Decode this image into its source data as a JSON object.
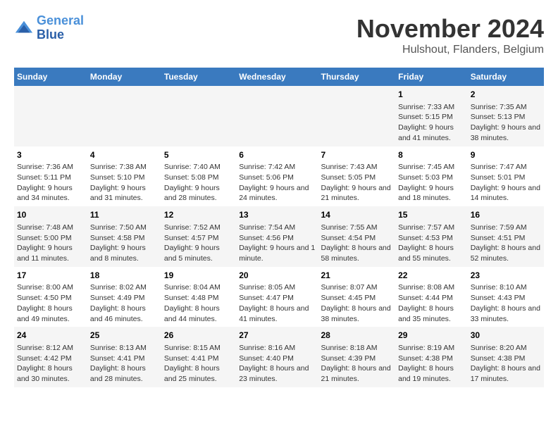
{
  "header": {
    "logo_line1": "General",
    "logo_line2": "Blue",
    "title": "November 2024",
    "subtitle": "Hulshout, Flanders, Belgium"
  },
  "days_of_week": [
    "Sunday",
    "Monday",
    "Tuesday",
    "Wednesday",
    "Thursday",
    "Friday",
    "Saturday"
  ],
  "weeks": [
    [
      {
        "day": "",
        "sunrise": "",
        "sunset": "",
        "daylight": ""
      },
      {
        "day": "",
        "sunrise": "",
        "sunset": "",
        "daylight": ""
      },
      {
        "day": "",
        "sunrise": "",
        "sunset": "",
        "daylight": ""
      },
      {
        "day": "",
        "sunrise": "",
        "sunset": "",
        "daylight": ""
      },
      {
        "day": "",
        "sunrise": "",
        "sunset": "",
        "daylight": ""
      },
      {
        "day": "1",
        "sunrise": "Sunrise: 7:33 AM",
        "sunset": "Sunset: 5:15 PM",
        "daylight": "Daylight: 9 hours and 41 minutes."
      },
      {
        "day": "2",
        "sunrise": "Sunrise: 7:35 AM",
        "sunset": "Sunset: 5:13 PM",
        "daylight": "Daylight: 9 hours and 38 minutes."
      }
    ],
    [
      {
        "day": "3",
        "sunrise": "Sunrise: 7:36 AM",
        "sunset": "Sunset: 5:11 PM",
        "daylight": "Daylight: 9 hours and 34 minutes."
      },
      {
        "day": "4",
        "sunrise": "Sunrise: 7:38 AM",
        "sunset": "Sunset: 5:10 PM",
        "daylight": "Daylight: 9 hours and 31 minutes."
      },
      {
        "day": "5",
        "sunrise": "Sunrise: 7:40 AM",
        "sunset": "Sunset: 5:08 PM",
        "daylight": "Daylight: 9 hours and 28 minutes."
      },
      {
        "day": "6",
        "sunrise": "Sunrise: 7:42 AM",
        "sunset": "Sunset: 5:06 PM",
        "daylight": "Daylight: 9 hours and 24 minutes."
      },
      {
        "day": "7",
        "sunrise": "Sunrise: 7:43 AM",
        "sunset": "Sunset: 5:05 PM",
        "daylight": "Daylight: 9 hours and 21 minutes."
      },
      {
        "day": "8",
        "sunrise": "Sunrise: 7:45 AM",
        "sunset": "Sunset: 5:03 PM",
        "daylight": "Daylight: 9 hours and 18 minutes."
      },
      {
        "day": "9",
        "sunrise": "Sunrise: 7:47 AM",
        "sunset": "Sunset: 5:01 PM",
        "daylight": "Daylight: 9 hours and 14 minutes."
      }
    ],
    [
      {
        "day": "10",
        "sunrise": "Sunrise: 7:48 AM",
        "sunset": "Sunset: 5:00 PM",
        "daylight": "Daylight: 9 hours and 11 minutes."
      },
      {
        "day": "11",
        "sunrise": "Sunrise: 7:50 AM",
        "sunset": "Sunset: 4:58 PM",
        "daylight": "Daylight: 9 hours and 8 minutes."
      },
      {
        "day": "12",
        "sunrise": "Sunrise: 7:52 AM",
        "sunset": "Sunset: 4:57 PM",
        "daylight": "Daylight: 9 hours and 5 minutes."
      },
      {
        "day": "13",
        "sunrise": "Sunrise: 7:54 AM",
        "sunset": "Sunset: 4:56 PM",
        "daylight": "Daylight: 9 hours and 1 minute."
      },
      {
        "day": "14",
        "sunrise": "Sunrise: 7:55 AM",
        "sunset": "Sunset: 4:54 PM",
        "daylight": "Daylight: 8 hours and 58 minutes."
      },
      {
        "day": "15",
        "sunrise": "Sunrise: 7:57 AM",
        "sunset": "Sunset: 4:53 PM",
        "daylight": "Daylight: 8 hours and 55 minutes."
      },
      {
        "day": "16",
        "sunrise": "Sunrise: 7:59 AM",
        "sunset": "Sunset: 4:51 PM",
        "daylight": "Daylight: 8 hours and 52 minutes."
      }
    ],
    [
      {
        "day": "17",
        "sunrise": "Sunrise: 8:00 AM",
        "sunset": "Sunset: 4:50 PM",
        "daylight": "Daylight: 8 hours and 49 minutes."
      },
      {
        "day": "18",
        "sunrise": "Sunrise: 8:02 AM",
        "sunset": "Sunset: 4:49 PM",
        "daylight": "Daylight: 8 hours and 46 minutes."
      },
      {
        "day": "19",
        "sunrise": "Sunrise: 8:04 AM",
        "sunset": "Sunset: 4:48 PM",
        "daylight": "Daylight: 8 hours and 44 minutes."
      },
      {
        "day": "20",
        "sunrise": "Sunrise: 8:05 AM",
        "sunset": "Sunset: 4:47 PM",
        "daylight": "Daylight: 8 hours and 41 minutes."
      },
      {
        "day": "21",
        "sunrise": "Sunrise: 8:07 AM",
        "sunset": "Sunset: 4:45 PM",
        "daylight": "Daylight: 8 hours and 38 minutes."
      },
      {
        "day": "22",
        "sunrise": "Sunrise: 8:08 AM",
        "sunset": "Sunset: 4:44 PM",
        "daylight": "Daylight: 8 hours and 35 minutes."
      },
      {
        "day": "23",
        "sunrise": "Sunrise: 8:10 AM",
        "sunset": "Sunset: 4:43 PM",
        "daylight": "Daylight: 8 hours and 33 minutes."
      }
    ],
    [
      {
        "day": "24",
        "sunrise": "Sunrise: 8:12 AM",
        "sunset": "Sunset: 4:42 PM",
        "daylight": "Daylight: 8 hours and 30 minutes."
      },
      {
        "day": "25",
        "sunrise": "Sunrise: 8:13 AM",
        "sunset": "Sunset: 4:41 PM",
        "daylight": "Daylight: 8 hours and 28 minutes."
      },
      {
        "day": "26",
        "sunrise": "Sunrise: 8:15 AM",
        "sunset": "Sunset: 4:41 PM",
        "daylight": "Daylight: 8 hours and 25 minutes."
      },
      {
        "day": "27",
        "sunrise": "Sunrise: 8:16 AM",
        "sunset": "Sunset: 4:40 PM",
        "daylight": "Daylight: 8 hours and 23 minutes."
      },
      {
        "day": "28",
        "sunrise": "Sunrise: 8:18 AM",
        "sunset": "Sunset: 4:39 PM",
        "daylight": "Daylight: 8 hours and 21 minutes."
      },
      {
        "day": "29",
        "sunrise": "Sunrise: 8:19 AM",
        "sunset": "Sunset: 4:38 PM",
        "daylight": "Daylight: 8 hours and 19 minutes."
      },
      {
        "day": "30",
        "sunrise": "Sunrise: 8:20 AM",
        "sunset": "Sunset: 4:38 PM",
        "daylight": "Daylight: 8 hours and 17 minutes."
      }
    ]
  ]
}
